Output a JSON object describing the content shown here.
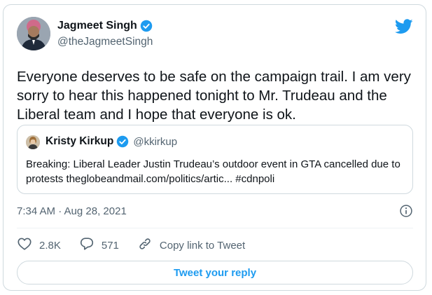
{
  "tweet": {
    "author_name": "Jagmeet Singh",
    "author_handle": "@theJagmeetSingh",
    "text": "Everyone deserves to be safe on the campaign trail. I am very sorry to hear this happened tonight to Mr. Trudeau and the Liberal team and I hope that everyone is ok.",
    "timestamp": "7:34 AM · Aug 28, 2021"
  },
  "quoted_tweet": {
    "author_name": "Kristy Kirkup",
    "author_handle": "@kkirkup",
    "text": "Breaking: Liberal Leader Justin Trudeau’s outdoor event in GTA cancelled due to protests theglobeandmail.com/politics/artic... #cdnpoli"
  },
  "actions": {
    "like_count": "2.8K",
    "reply_count": "571",
    "copy_link_label": "Copy link to Tweet"
  },
  "reply_button_label": "Tweet your reply",
  "icons": {
    "verified": "verified-badge-icon",
    "brand": "twitter-bird-icon",
    "info": "info-icon",
    "like": "heart-icon",
    "reply": "speech-bubble-icon",
    "link": "link-icon"
  },
  "colors": {
    "accent": "#1d9bf0",
    "text": "#0f1419",
    "secondary": "#536471",
    "border": "#cfd9de"
  }
}
